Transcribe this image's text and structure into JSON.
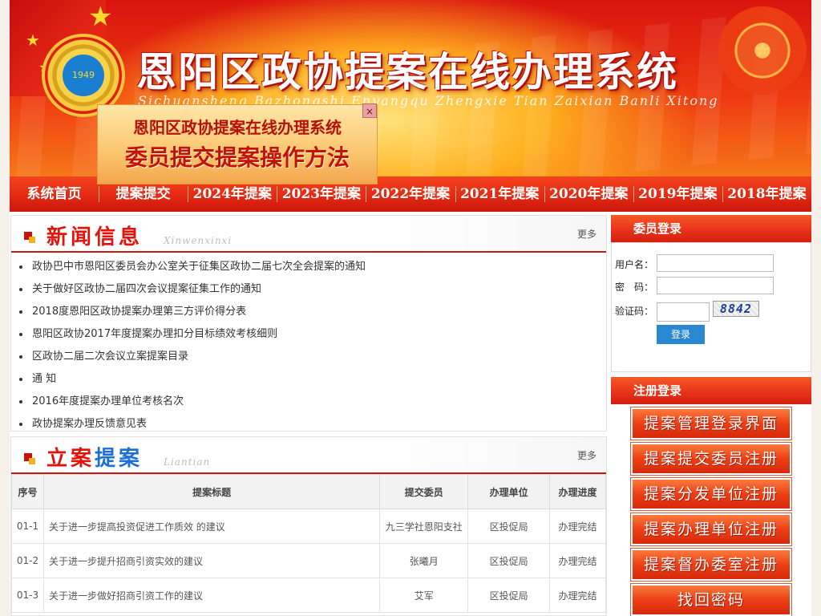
{
  "banner": {
    "title": "恩阳区政协提案在线办理系统",
    "pinyin": "Sichuansheng Bazhongshi Enyangqu Zhengxie Tian Zaixian Banli Xitong",
    "emblem_text": "1949"
  },
  "promo": {
    "line1": "恩阳区政协提案在线办理系统",
    "line2": "委员提交提案操作方法",
    "close": "×"
  },
  "nav": [
    "系统首页",
    "提案提交",
    "2024年提案",
    "2023年提案",
    "2022年提案",
    "2021年提案",
    "2020年提案",
    "2019年提案",
    "2018年提案"
  ],
  "news": {
    "title": "新闻信息",
    "subtitle": "Xinwenxinxi",
    "more": "更多",
    "items": [
      "政协巴中市恩阳区委员会办公室关于征集区政协二届七次全会提案的通知",
      "关于做好区政协二届四次会议提案征集工作的通知",
      "2018度恩阳区政协提案办理第三方评价得分表",
      "恩阳区政协2017年度提案办理扣分目标绩效考核细则",
      "区政协二届二次会议立案提案目录",
      "通  知",
      "2016年度提案办理单位考核名次",
      "政协提案办理反馈意见表"
    ]
  },
  "cases": {
    "title_a": "立案",
    "title_b": "提案",
    "subtitle": "Liantian",
    "more": "更多",
    "headers": [
      "序号",
      "提案标题",
      "提交委员",
      "办理单位",
      "办理进度"
    ],
    "rows": [
      [
        "01-1",
        "关于进一步提高投资促进工作质效 的建议",
        "九三学社恩阳支社",
        "区投促局",
        "办理完结"
      ],
      [
        "01-2",
        "关于进一步提升招商引资实效的建议",
        "张曦月",
        "区投促局",
        "办理完结"
      ],
      [
        "01-3",
        "关于进一步做好招商引资工作的建议",
        "艾军",
        "区投促局",
        "办理完结"
      ]
    ]
  },
  "login": {
    "header": "委员登录",
    "username_label": "用户名：",
    "password_label": "密　码：",
    "captcha_label": "验证码：",
    "captcha_code": "8842",
    "submit": "登录"
  },
  "register": {
    "header": "注册登录",
    "buttons": [
      "提案管理登录界面",
      "提案提交委员注册",
      "提案分发单位注册",
      "提案办理单位注册",
      "提案督办委室注册",
      "找回密码"
    ]
  },
  "colors": {
    "brand_red": "#e2130b",
    "accent_blue": "#1d6fd6",
    "login_blue": "#2a88d2"
  }
}
